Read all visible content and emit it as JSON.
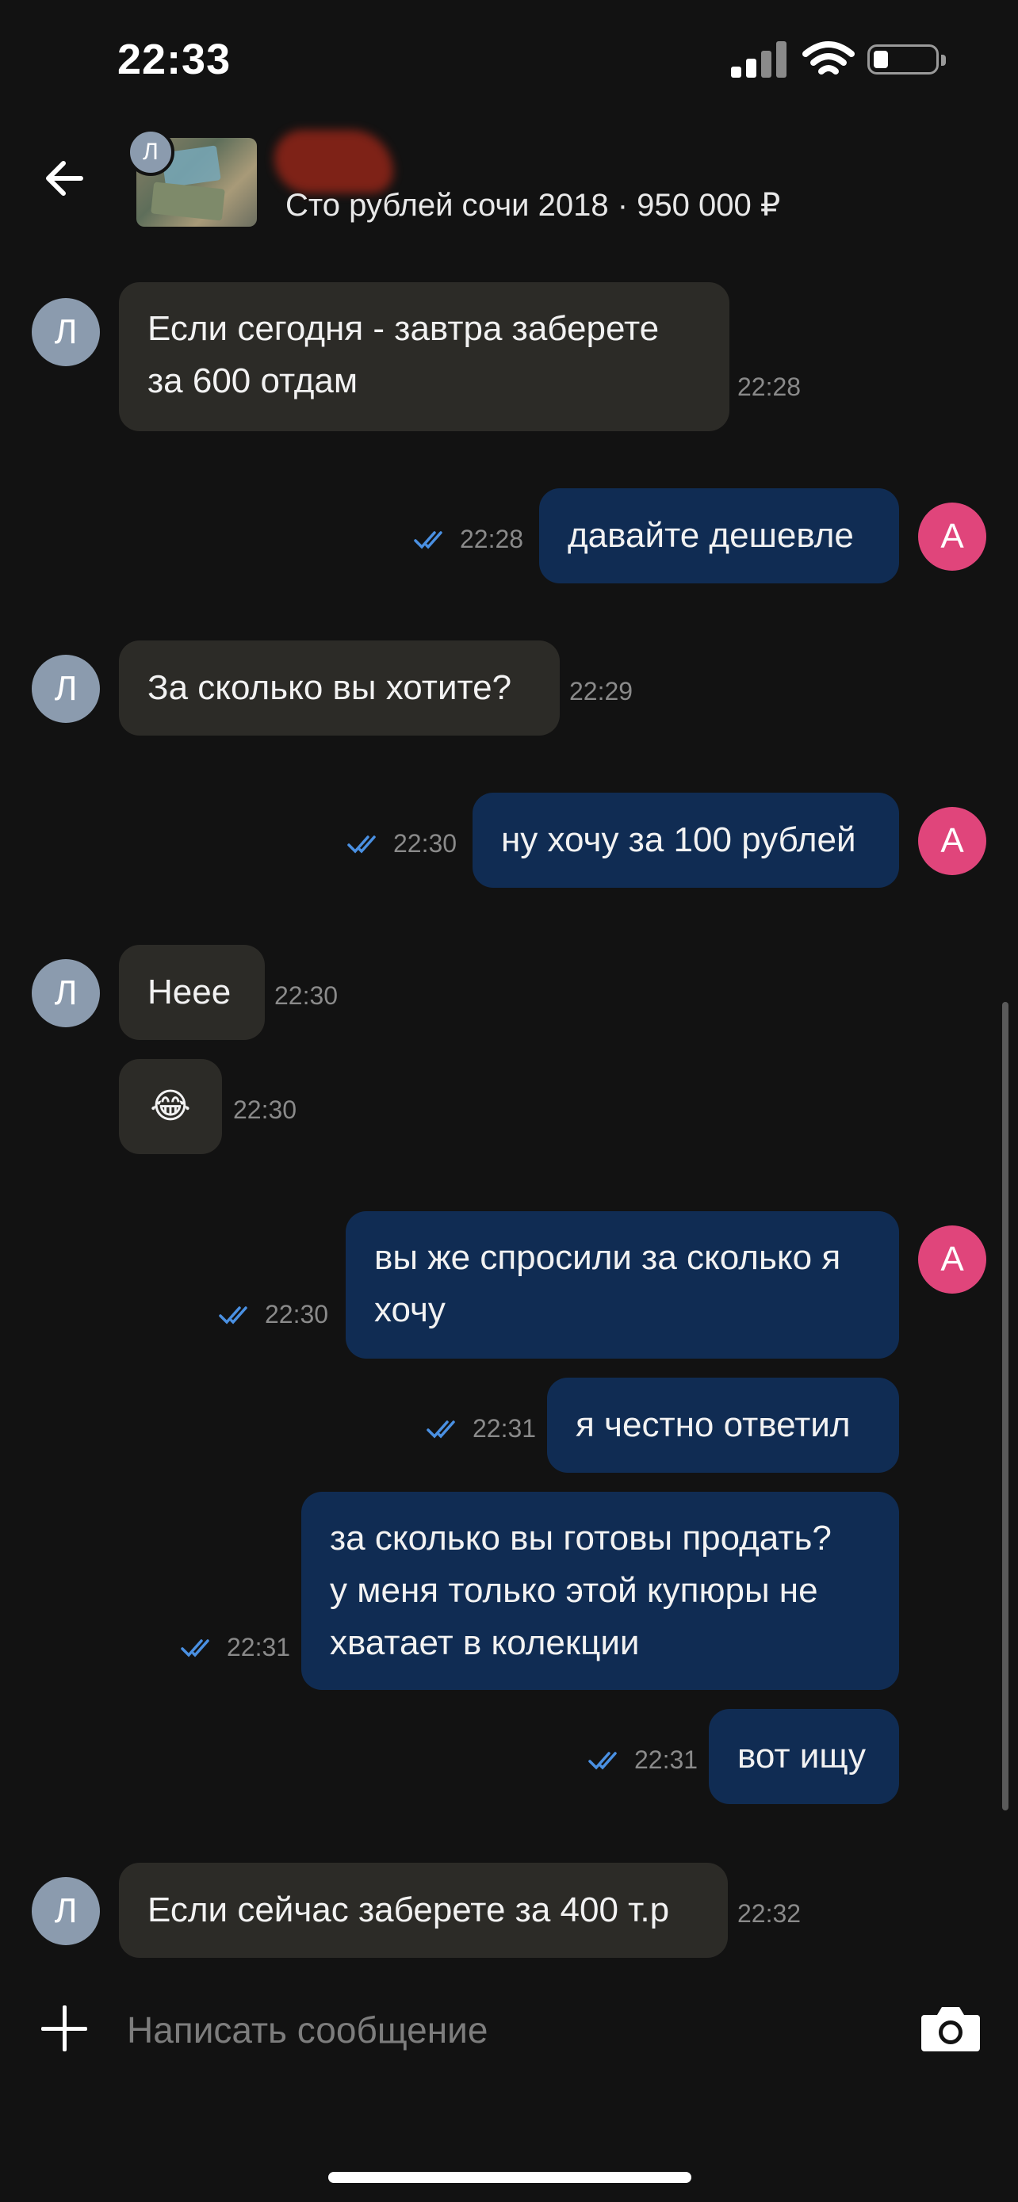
{
  "status_bar": {
    "time": "22:33"
  },
  "header": {
    "avatar_letter": "Л",
    "subtitle": "Сто рублей сочи 2018 · 950 000 ₽"
  },
  "messages": [
    {
      "dir": "in",
      "lines": [
        "Если сегодня - завтра заберете",
        "за 600 отдам"
      ],
      "time": "22:28",
      "avatar": "Л"
    },
    {
      "dir": "out",
      "lines": [
        "давайте дешевле"
      ],
      "time": "22:28",
      "avatar": "А"
    },
    {
      "dir": "in",
      "lines": [
        "За сколько вы хотите?"
      ],
      "time": "22:29",
      "avatar": "Л"
    },
    {
      "dir": "out",
      "lines": [
        "ну хочу за 100 рублей"
      ],
      "time": "22:30",
      "avatar": "А"
    },
    {
      "dir": "in",
      "lines": [
        "Неее"
      ],
      "time": "22:30",
      "avatar": "Л"
    },
    {
      "dir": "in",
      "lines": [
        "😂"
      ],
      "time": "22:30"
    },
    {
      "dir": "out",
      "lines": [
        "вы же спросили за сколько я",
        "хочу"
      ],
      "time": "22:30",
      "avatar": "А"
    },
    {
      "dir": "out",
      "lines": [
        "я честно ответил"
      ],
      "time": "22:31"
    },
    {
      "dir": "out",
      "lines": [
        "за сколько вы готовы продать?",
        "у меня только этой купюры не",
        "хватает в колекции"
      ],
      "time": "22:31"
    },
    {
      "dir": "out",
      "lines": [
        "вот ищу"
      ],
      "time": "22:31"
    },
    {
      "dir": "in",
      "lines": [
        "Если сейчас заберете за 400 т.р"
      ],
      "time": "22:32",
      "avatar": "Л"
    }
  ],
  "composer": {
    "placeholder": "Написать сообщение"
  },
  "colors": {
    "incoming_bubble": "#2c2b27",
    "outgoing_bubble": "#102c53",
    "read_ticks": "#4a90e2",
    "own_avatar": "#e0457b",
    "peer_avatar": "#8b9bae"
  }
}
